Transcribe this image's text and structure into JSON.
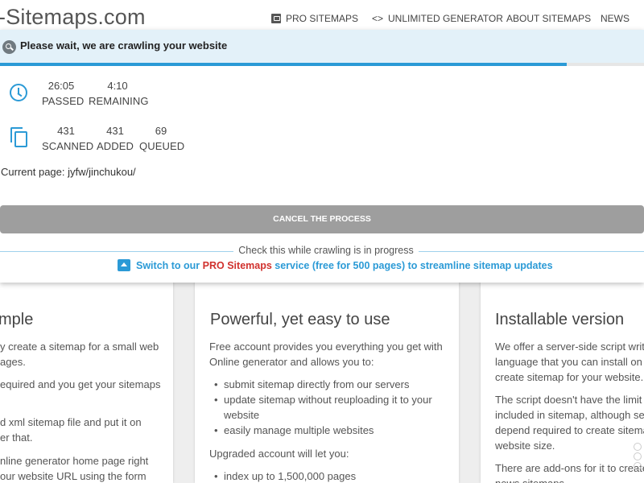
{
  "header": {
    "logo": "-Sitemaps.com",
    "nav": [
      {
        "label": "PRO SITEMAPS",
        "icon": "pro-box-icon"
      },
      {
        "label": "UNLIMITED GENERATOR",
        "icon": "code-brackets-icon"
      },
      {
        "label": "ABOUT SITEMAPS"
      },
      {
        "label": "NEWS"
      }
    ]
  },
  "modal": {
    "title": "Please wait, we are crawling your website",
    "progress_fraction": 0.88,
    "time": {
      "passed_value": "26:05",
      "passed_label": "PASSED",
      "remaining_value": "4:10",
      "remaining_label": "REMAINING"
    },
    "pages": {
      "scanned_value": "431",
      "scanned_label": "SCANNED",
      "added_value": "431",
      "added_label": "ADDED",
      "queued_value": "69",
      "queued_label": "QUEUED"
    },
    "current_label": "Current page:",
    "current_value": "jyfw/jinchukou/",
    "cancel_label": "CANCEL THE PROCESS",
    "check_text": "Check this while crawling is in progress",
    "promo_prefix": "Switch to our",
    "promo_highlight": "PRO Sitemaps",
    "promo_suffix": "service (free for 500 pages) to streamline sitemap updates"
  },
  "cards": {
    "c1": {
      "title": "mple",
      "lines": [
        "y create a sitemap for a small web",
        "ages.",
        "equired and you get your sitemaps",
        "d xml sitemap file and put it on",
        "er that.",
        "nline generator home page right",
        "our website URL using the form"
      ]
    },
    "c2": {
      "title": "Powerful, yet easy to use",
      "intro1": "Free account provides you everything you get with",
      "intro2": "Online generator and allows you to:",
      "bullets": [
        "submit sitemap directly from our servers",
        "update sitemap without reuploading it to your",
        "website",
        "easily manage multiple websites"
      ],
      "upgraded": "Upgraded account will let you:",
      "bullets2": [
        "index up to 1,500,000 pages"
      ]
    },
    "c3": {
      "title": "Installable version",
      "lines": [
        "We offer a server-side script writte",
        "language that you can install on y",
        "create sitemap for your website.",
        "The script doesn't have the limit o",
        "included in sitemap, although serv",
        "depend required to create sitemap",
        "website size.",
        "There are add-ons for it to create",
        "news sitemaps"
      ]
    }
  }
}
